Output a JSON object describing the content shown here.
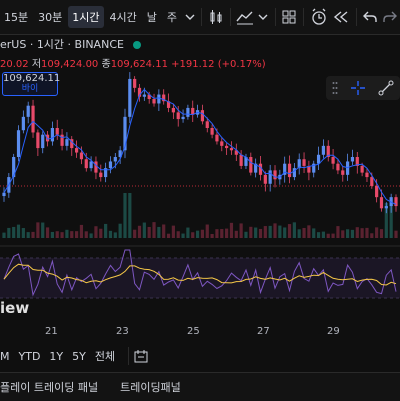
{
  "toolbar": {
    "timeframes": [
      {
        "label": "15분",
        "active": false
      },
      {
        "label": "30분",
        "active": false
      },
      {
        "label": "1시간",
        "active": true
      },
      {
        "label": "4시간",
        "active": false
      },
      {
        "label": "날",
        "active": false
      },
      {
        "label": "주",
        "active": false
      }
    ]
  },
  "legend": {
    "symbol": "erUS · 1시간 · BINANCE"
  },
  "ohlc": {
    "h_partial": "20.02",
    "l_label": "저",
    "l_value": "109,424.00",
    "c_label": "종",
    "c_value": "109,624.11",
    "change": "+191.12 (+0.17%)"
  },
  "buy_box": {
    "price": "109,624.11",
    "label": "바이"
  },
  "pane_label": "iew",
  "xaxis": {
    "labels": [
      "21",
      "23",
      "25",
      "27",
      "29"
    ]
  },
  "range_bar": {
    "items": [
      "M",
      "YTD",
      "1Y",
      "5Y",
      "전체"
    ]
  },
  "bottom_tabs": [
    "플레이 트레이딩 패널",
    "트레이딩패널"
  ],
  "colors": {
    "up": "#089981",
    "down": "#f23645",
    "candle_up": "#5b8def",
    "candle_down": "#e84a6a",
    "ma": "#2962ff",
    "rsi": "#7e57c2",
    "rsi_signal": "#f7c948",
    "price_line": "#f23645"
  },
  "chart_data": {
    "type": "candlestick",
    "close": [
      107500,
      108200,
      109100,
      110300,
      110900,
      111400,
      110200,
      109500,
      110100,
      109800,
      110400,
      110100,
      109600,
      109900,
      109500,
      109300,
      109000,
      108600,
      108900,
      108400,
      108200,
      108600,
      108900,
      109100,
      109400,
      110900,
      112600,
      112200,
      111800,
      111900,
      111700,
      111500,
      111900,
      111600,
      111300,
      111100,
      110800,
      110900,
      111300,
      111000,
      111200,
      110700,
      110400,
      110100,
      109800,
      109600,
      109500,
      109400,
      109200,
      108700,
      109100,
      108400,
      108800,
      108300,
      107900,
      108500,
      108100,
      108300,
      108800,
      108200,
      108600,
      109000,
      108700,
      108400,
      108800,
      109200,
      109600,
      109100,
      108800,
      108500,
      108300,
      108900,
      109100,
      108700,
      108400,
      108200,
      107800,
      107300,
      106800,
      106900,
      107300,
      106900
    ]
  }
}
